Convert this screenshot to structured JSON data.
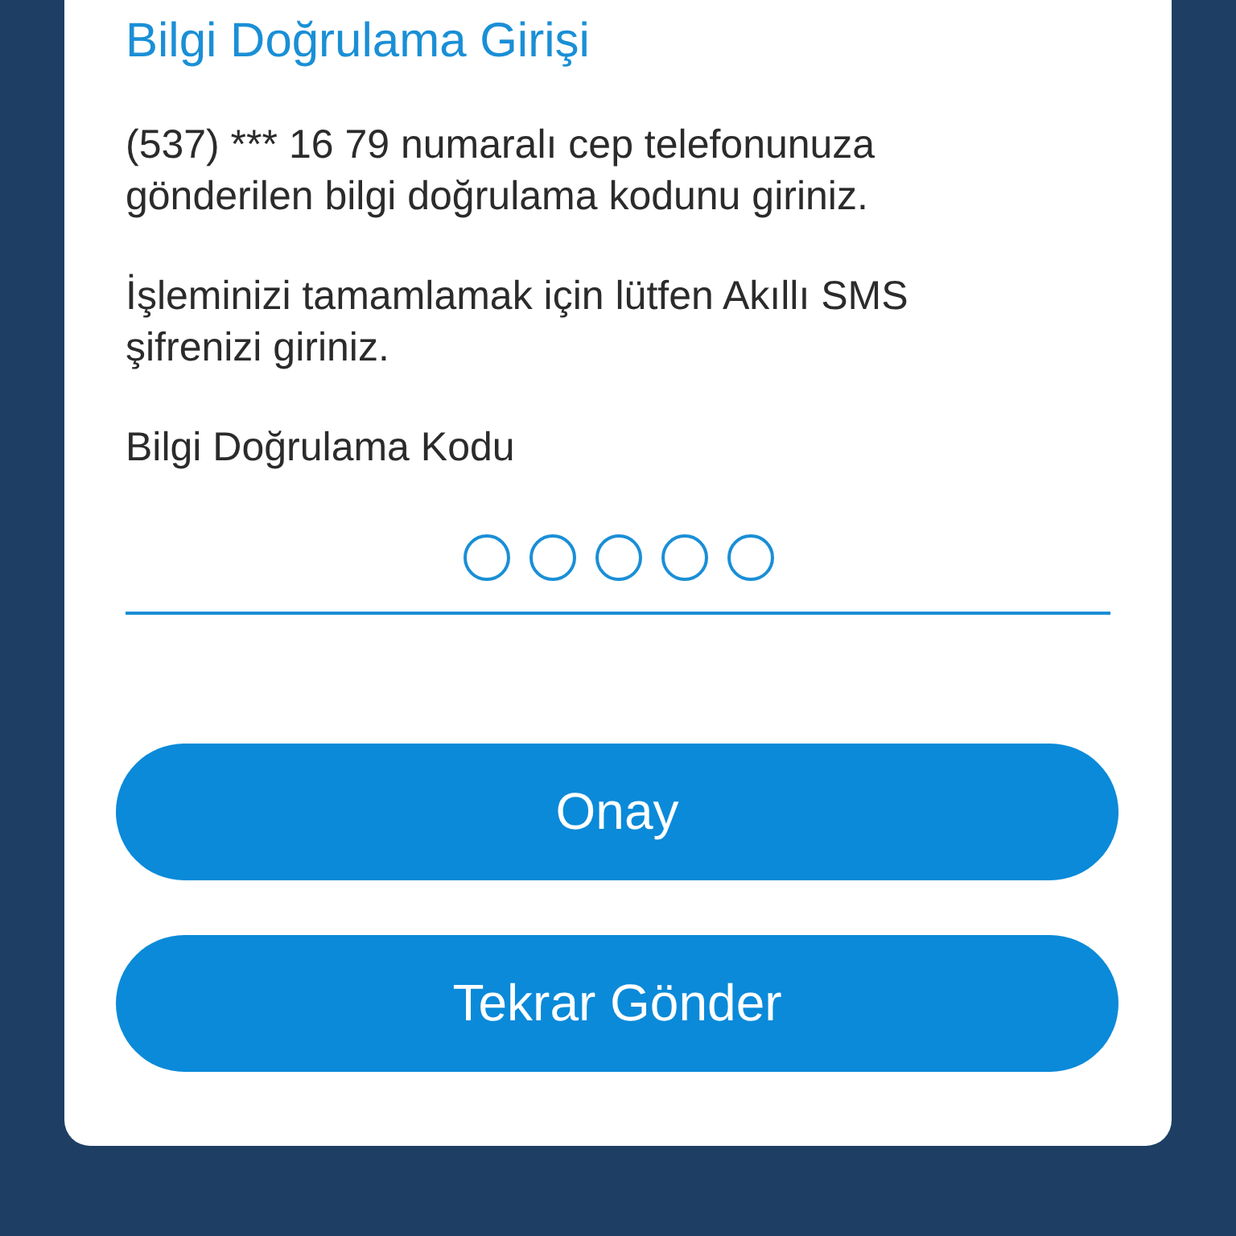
{
  "title": "Bilgi Doğrulama Girişi",
  "paragraphs": [
    "(537) *** 16 79 numaralı cep telefonunuza gönderilen bilgi doğrulama kodunu giriniz.",
    "İşleminizi tamamlamak için lütfen Akıllı SMS şifrenizi giriniz."
  ],
  "code_field": {
    "label": "Bilgi Doğrulama Kodu",
    "digits": [
      {
        "filled": false
      },
      {
        "filled": false
      },
      {
        "filled": false
      },
      {
        "filled": false
      },
      {
        "filled": false
      }
    ]
  },
  "buttons": [
    "Onay",
    "Tekrar Gönder"
  ]
}
